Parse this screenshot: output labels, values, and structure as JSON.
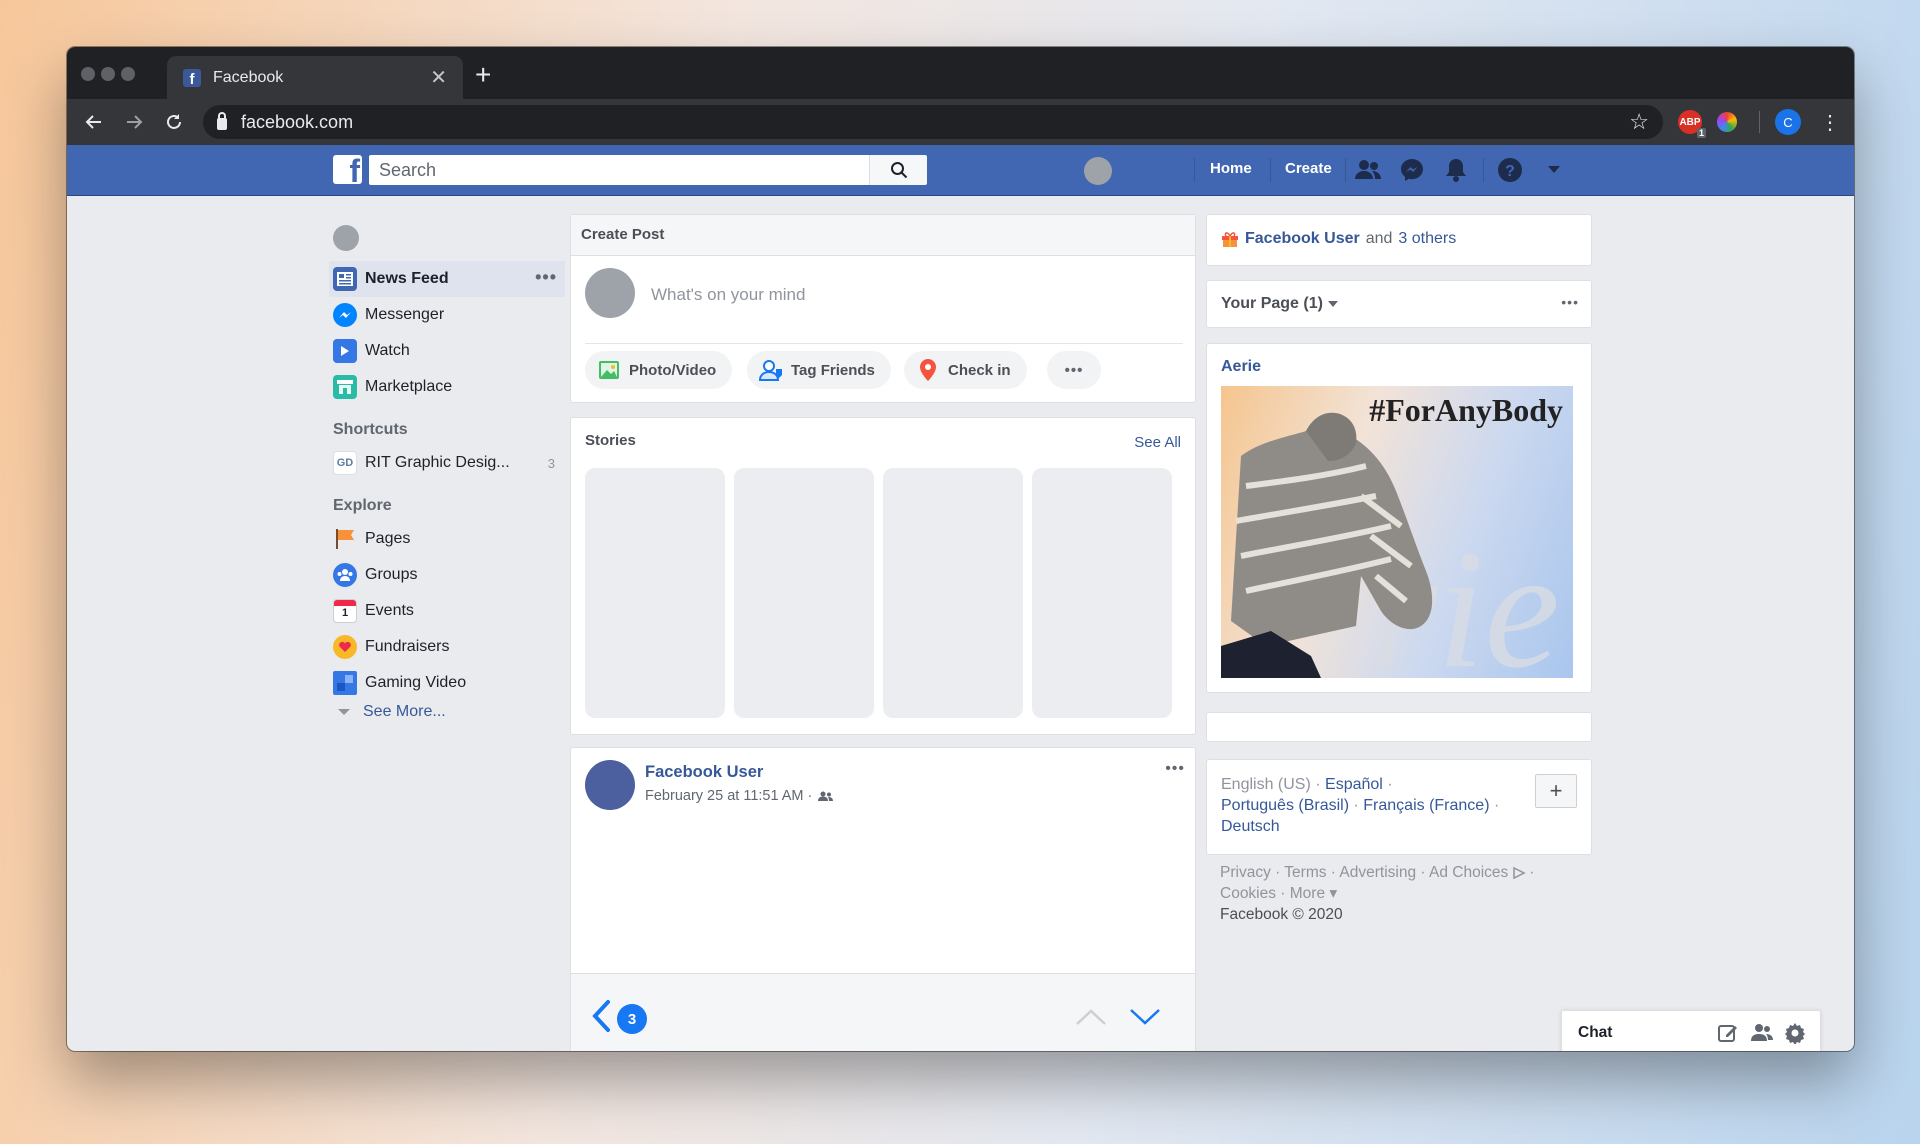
{
  "browser": {
    "tab_title": "Facebook",
    "url": "facebook.com",
    "extensions": [
      {
        "name": "adblock-icon",
        "label": "ABP",
        "badge": "1"
      },
      {
        "name": "color-wheel-icon"
      },
      {
        "name": "profile-avatar",
        "label": "C"
      }
    ]
  },
  "fb": {
    "search_placeholder": "Search",
    "nav": {
      "home": "Home",
      "create": "Create"
    }
  },
  "left": {
    "items": [
      {
        "label": "News Feed",
        "icon": "news-feed-icon"
      },
      {
        "label": "Messenger",
        "icon": "messenger-icon"
      },
      {
        "label": "Watch",
        "icon": "watch-icon"
      },
      {
        "label": "Marketplace",
        "icon": "marketplace-icon"
      }
    ],
    "shortcuts_heading": "Shortcuts",
    "shortcut": {
      "label": "RIT Graphic Desig...",
      "count": "3",
      "icon_text": "GD"
    },
    "explore_heading": "Explore",
    "explore": [
      {
        "label": "Pages",
        "icon": "pages-flag-icon"
      },
      {
        "label": "Groups",
        "icon": "groups-icon"
      },
      {
        "label": "Events",
        "icon": "events-calendar-icon"
      },
      {
        "label": "Fundraisers",
        "icon": "fundraisers-icon"
      },
      {
        "label": "Gaming Video",
        "icon": "gaming-video-icon"
      }
    ],
    "see_more": "See More..."
  },
  "composer": {
    "title": "Create Post",
    "placeholder": "What's on your mind",
    "actions": [
      "Photo/Video",
      "Tag Friends",
      "Check in"
    ]
  },
  "stories": {
    "title": "Stories",
    "see_all": "See All"
  },
  "post": {
    "author": "Facebook User",
    "timestamp": "February 25 at 11:51 AM ·",
    "pager_count": "3"
  },
  "right": {
    "birthday": {
      "name": "Facebook User",
      "middle": "and",
      "others": "3 others"
    },
    "your_page": "Your Page (1)",
    "ad": {
      "advertiser": "Aerie",
      "tagline": "#ForAnyBody"
    },
    "languages": {
      "current": "English (US) ·",
      "options": [
        "Español",
        "Português (Brasil)",
        "Français (France)",
        "Deutsch"
      ]
    },
    "footer": {
      "line1": "Privacy · Terms · Advertising · Ad Choices",
      "line2": "Cookies · More ▾",
      "line3": "Facebook © 2020"
    }
  },
  "chat": {
    "label": "Chat"
  },
  "colors": {
    "fb_blue": "#4267b2",
    "link": "#365899",
    "background": "#e9ebee"
  }
}
